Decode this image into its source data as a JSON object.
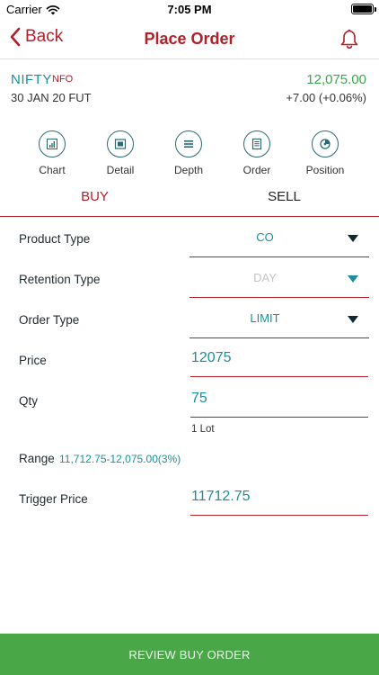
{
  "status_bar": {
    "carrier": "Carrier",
    "time": "7:05 PM",
    "icons": [
      "wifi-icon",
      "battery-icon"
    ]
  },
  "header": {
    "back_label": "Back",
    "title": "Place Order",
    "right_icon": "bell-icon"
  },
  "instrument": {
    "symbol": "NIFTY",
    "exchange": "NFO",
    "expiry": "30 JAN 20 FUT",
    "ltp": "12,075.00",
    "change": "+7.00 (+0.06%)"
  },
  "actions": [
    {
      "label": "Chart",
      "icon": "chart-icon"
    },
    {
      "label": "Detail",
      "icon": "detail-icon"
    },
    {
      "label": "Depth",
      "icon": "depth-icon"
    },
    {
      "label": "Order",
      "icon": "order-icon"
    },
    {
      "label": "Position",
      "icon": "position-icon"
    }
  ],
  "tabs": [
    {
      "label": "BUY",
      "active": true
    },
    {
      "label": "SELL",
      "active": false
    }
  ],
  "form": {
    "product_type": {
      "label": "Product Type",
      "value": "CO"
    },
    "retention_type": {
      "label": "Retention Type",
      "value": "DAY"
    },
    "order_type": {
      "label": "Order Type",
      "value": "LIMIT"
    },
    "price": {
      "label": "Price",
      "value": "12075"
    },
    "qty": {
      "label": "Qty",
      "value": "75",
      "lot_text": "1 Lot"
    },
    "range": {
      "label": "Range",
      "value": "11,712.75-12,075.00(3%)"
    },
    "trigger_price": {
      "label": "Trigger Price",
      "value": "11712.75"
    }
  },
  "footer": {
    "button_label": "REVIEW BUY ORDER"
  },
  "colors": {
    "accent_red": "#b3202a",
    "teal": "#1a8f9b",
    "green_up": "#3aa44e",
    "button_green": "#4aa748"
  }
}
